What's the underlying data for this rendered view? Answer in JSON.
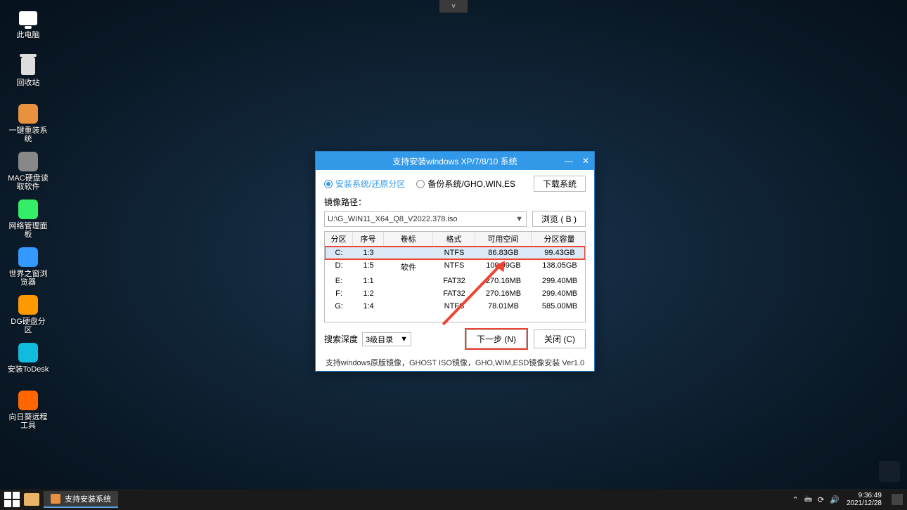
{
  "top_chevron": "˅",
  "desktop": {
    "items": [
      {
        "name": "此电脑",
        "icon": "pc"
      },
      {
        "name": "回收站",
        "icon": "bin"
      },
      {
        "name": "一键重装系统",
        "icon": "sq",
        "bg": "#e8923f"
      },
      {
        "name": "MAC硬盘读取软件",
        "icon": "sq",
        "bg": "#888"
      },
      {
        "name": "网络管理面板",
        "icon": "sq",
        "bg": "#3e6"
      },
      {
        "name": "世界之窗浏览器",
        "icon": "sq",
        "bg": "#39f"
      },
      {
        "name": "DG硬盘分区",
        "icon": "sq",
        "bg": "#f90"
      },
      {
        "name": "安装ToDesk",
        "icon": "sq",
        "bg": "#1bd"
      },
      {
        "name": "向日葵远程工具",
        "icon": "sq",
        "bg": "#f60"
      }
    ]
  },
  "dialog": {
    "title": "支持安装windows XP/7/8/10 系统",
    "radio_install": "安装系统/还原分区",
    "radio_backup": "备份系统/GHO,WIN,ES",
    "download_btn": "下载系统",
    "path_label": "镜像路径：",
    "path_value": "U:\\G_WIN11_X64_Q8_V2022.378.iso",
    "browse_btn": "浏览 ( B )",
    "headers": [
      "分区",
      "序号",
      "卷标",
      "格式",
      "可用空间",
      "分区容量"
    ],
    "rows": [
      {
        "p": "C:",
        "n": "1:3",
        "v": "",
        "f": "NTFS",
        "free": "86.83GB",
        "cap": "99.43GB"
      },
      {
        "p": "D:",
        "n": "1:5",
        "v": "软件",
        "f": "NTFS",
        "free": "109.99GB",
        "cap": "138.05GB"
      },
      {
        "p": "E:",
        "n": "1:1",
        "v": "",
        "f": "FAT32",
        "free": "270.16MB",
        "cap": "299.40MB"
      },
      {
        "p": "F:",
        "n": "1:2",
        "v": "",
        "f": "FAT32",
        "free": "270.16MB",
        "cap": "299.40MB"
      },
      {
        "p": "G:",
        "n": "1:4",
        "v": "",
        "f": "NTFS",
        "free": "78.01MB",
        "cap": "585.00MB"
      }
    ],
    "depth_label": "搜索深度",
    "depth_value": "3级目录",
    "next_btn": "下一步 (N)",
    "close_btn": "关闭 (C)",
    "note": "支持windows原版镜像，GHOST ISO镜像，GHO,WIM,ESD镜像安装 Ver1.0"
  },
  "taskbar": {
    "item": "支持安装系统",
    "tray": [
      "⌃",
      "🖮",
      "⟳",
      "🔊"
    ],
    "time": "9:36:49",
    "date": "2021/12/28"
  }
}
